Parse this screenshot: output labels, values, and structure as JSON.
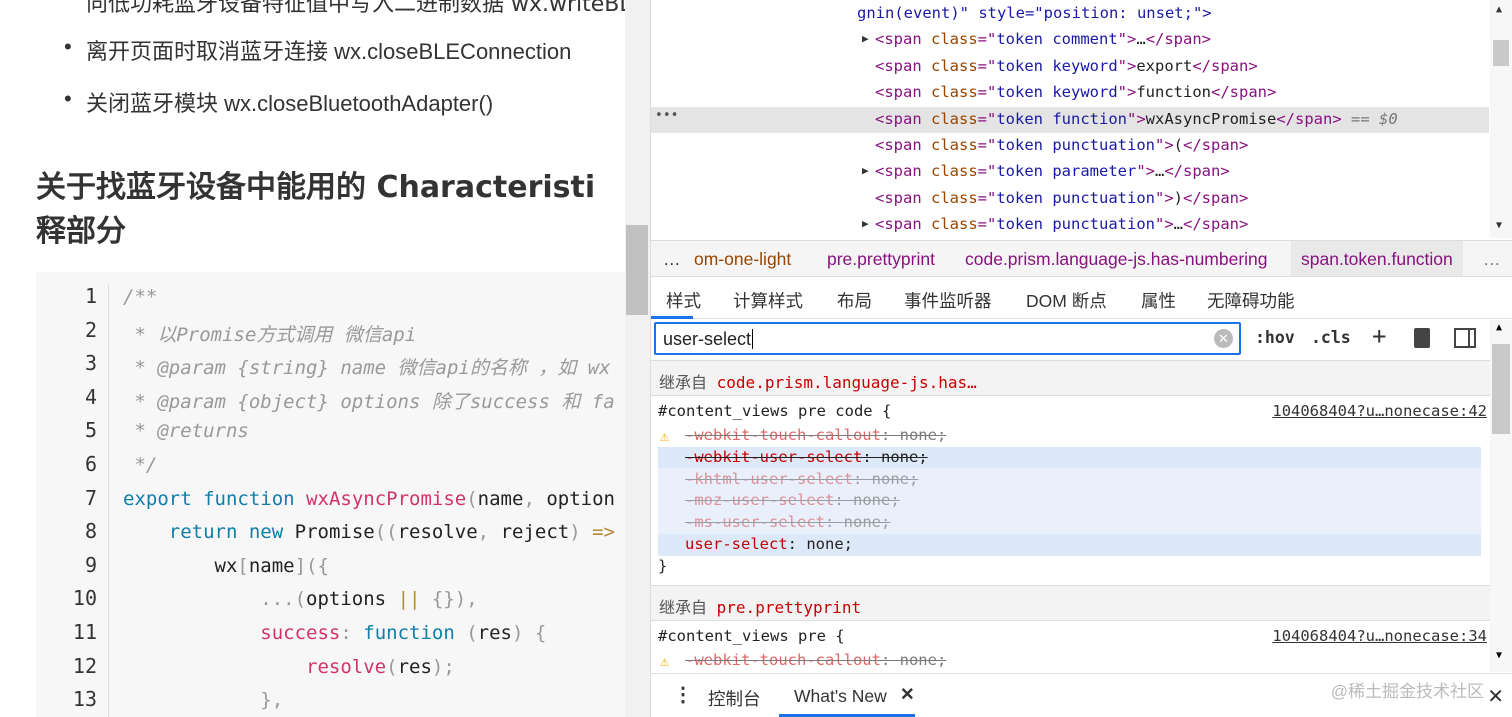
{
  "article": {
    "top_cut": "向低功耗蓝牙设备特征值中写入二进制数据 wx.writeBLECharacteristicValue",
    "bullets": [
      "离开页面时取消蓝牙连接 wx.closeBLEConnection",
      "关闭蓝牙模块 wx.closeBluetoothAdapter()"
    ],
    "heading_line1": "关于找蓝牙设备中能用的 Characteristi",
    "heading_line2": "释部分",
    "code_lines": [
      [
        [
          "/**",
          "t-comment"
        ]
      ],
      [
        [
          " * 以Promise方式调用 微信api",
          "t-comment"
        ]
      ],
      [
        [
          " * @param {string} name 微信api的名称 ，如 wx",
          "t-comment"
        ]
      ],
      [
        [
          " * @param {object} options 除了success 和 fa",
          "t-comment"
        ]
      ],
      [
        [
          " * @returns",
          "t-comment"
        ]
      ],
      [
        [
          " */",
          "t-comment"
        ]
      ],
      [
        [
          "export",
          "t-kw"
        ],
        [
          " ",
          ""
        ],
        [
          "function",
          "t-kw"
        ],
        [
          " ",
          ""
        ],
        [
          "wxAsyncPromise",
          "t-fn"
        ],
        [
          "(",
          "t-p"
        ],
        [
          "name",
          ""
        ],
        [
          ",",
          "t-p"
        ],
        [
          " option",
          ""
        ]
      ],
      [
        [
          "    ",
          ""
        ],
        [
          "return",
          "t-kw"
        ],
        [
          " ",
          ""
        ],
        [
          "new",
          "t-kw"
        ],
        [
          " Promise",
          ""
        ],
        [
          "((",
          "t-p"
        ],
        [
          "resolve",
          ""
        ],
        [
          ",",
          "t-p"
        ],
        [
          " reject",
          ""
        ],
        [
          ")",
          "t-p"
        ],
        [
          " =>",
          "t-op"
        ]
      ],
      [
        [
          "        wx",
          ""
        ],
        [
          "[",
          "t-p"
        ],
        [
          "name",
          ""
        ],
        [
          "]({",
          "t-p"
        ]
      ],
      [
        [
          "            ...",
          "t-p"
        ],
        [
          "(",
          "t-p"
        ],
        [
          "options ",
          ""
        ],
        [
          "||",
          "t-op"
        ],
        [
          " {}),",
          "t-p"
        ]
      ],
      [
        [
          "            ",
          ""
        ],
        [
          "success",
          "t-prop"
        ],
        [
          ":",
          "t-p"
        ],
        [
          " ",
          ""
        ],
        [
          "function",
          "t-kw"
        ],
        [
          " (",
          "t-p"
        ],
        [
          "res",
          ""
        ],
        [
          ")",
          "t-p"
        ],
        [
          " {",
          "t-p"
        ]
      ],
      [
        [
          "                ",
          ""
        ],
        [
          "resolve",
          "t-fn"
        ],
        [
          "(",
          "t-p"
        ],
        [
          "res",
          ""
        ],
        [
          ");",
          "t-p"
        ]
      ],
      [
        [
          "            },",
          "t-p"
        ]
      ]
    ]
  },
  "devtools": {
    "elements": [
      {
        "indent": 0,
        "html": "gnin(event)\" style=\"position: unset;\">"
      },
      {
        "tri": true,
        "cls": "token comment",
        "inner": "…"
      },
      {
        "cls": "token keyword",
        "inner": "export"
      },
      {
        "cls": "token keyword",
        "inner": "function"
      },
      {
        "cls": "token function",
        "inner": "wxAsyncPromise",
        "selected": true,
        "suffix": " == $0"
      },
      {
        "cls": "token punctuation",
        "inner": "("
      },
      {
        "tri": true,
        "cls": "token parameter",
        "inner": "…"
      },
      {
        "cls": "token punctuation",
        "inner": ")"
      },
      {
        "tri": true,
        "cls": "token punctuation",
        "inner": "…"
      }
    ],
    "breadcrumbs": [
      "…",
      "om-one-light",
      "pre.prettyprint",
      "code.prism.language-js.has-numbering",
      "span.token.function",
      "…"
    ],
    "tabs": [
      "样式",
      "计算样式",
      "布局",
      "事件监听器",
      "DOM 断点",
      "属性",
      "无障碍功能"
    ],
    "filter_value": "user-select",
    "toolbar": {
      "hov": ":hov",
      "cls": ".cls",
      "add": "+"
    },
    "inherited1": {
      "label": "继承自",
      "selector": "code.prism.language-js.has…"
    },
    "rule1": {
      "selector": "#content_views pre code {",
      "source": "104068404?u…nonecase:42",
      "close": "}",
      "props": [
        {
          "name": "-webkit-touch-callout",
          "value": "none"
        },
        {
          "name": "-webkit-user-select",
          "value": "none"
        },
        {
          "name": "-khtml-user-select",
          "value": "none"
        },
        {
          "name": "-moz-user-select",
          "value": "none"
        },
        {
          "name": "-ms-user-select",
          "value": "none"
        },
        {
          "name": "user-select",
          "value": "none"
        }
      ]
    },
    "inherited2": {
      "label": "继承自",
      "selector": "pre.prettyprint"
    },
    "rule2": {
      "selector": "#content_views pre {",
      "source": "104068404?u…nonecase:34",
      "props": [
        {
          "name": "-webkit-touch-callout",
          "value": "none"
        }
      ]
    },
    "drawer": {
      "tabs": [
        "控制台",
        "What's New"
      ],
      "close": "✕"
    },
    "watermark": "@稀土掘金技术社区"
  }
}
